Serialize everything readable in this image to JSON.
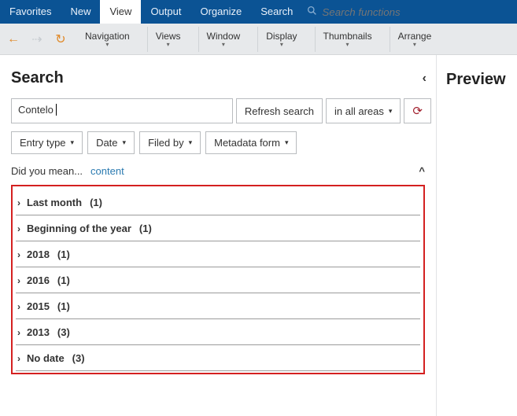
{
  "topbar": {
    "tabs": [
      "Favorites",
      "New",
      "View",
      "Output",
      "Organize",
      "Search"
    ],
    "active_index": 2,
    "search_placeholder": "Search functions"
  },
  "toolbar": {
    "items": [
      "Navigation",
      "Views",
      "Window",
      "Display",
      "Thumbnails",
      "Arrange"
    ]
  },
  "search": {
    "heading": "Search",
    "preview_heading": "Preview",
    "query_value": "Contelo",
    "refresh_label": "Refresh search",
    "area_label": "in all areas",
    "filters": {
      "entry_type": "Entry type",
      "date": "Date",
      "filed_by": "Filed by",
      "metadata": "Metadata form"
    },
    "didyoumean_label": "Did you mean...",
    "didyoumean_suggestion": "content"
  },
  "results": [
    {
      "label": "Last month",
      "count": "(1)"
    },
    {
      "label": "Beginning of the year",
      "count": "(1)"
    },
    {
      "label": "2018",
      "count": "(1)"
    },
    {
      "label": "2016",
      "count": "(1)"
    },
    {
      "label": "2015",
      "count": "(1)"
    },
    {
      "label": "2013",
      "count": "(3)"
    },
    {
      "label": "No date",
      "count": "(3)"
    }
  ]
}
